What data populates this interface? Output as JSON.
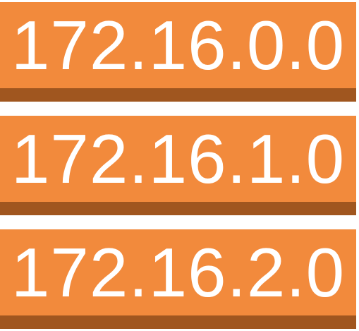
{
  "colors": {
    "block_face": "#f28a3c",
    "block_base": "#a0561f",
    "label_text": "#ffffff",
    "background": "#ffffff"
  },
  "blocks": [
    {
      "label": "172.16.0.0"
    },
    {
      "label": "172.16.1.0"
    },
    {
      "label": "172.16.2.0"
    }
  ]
}
